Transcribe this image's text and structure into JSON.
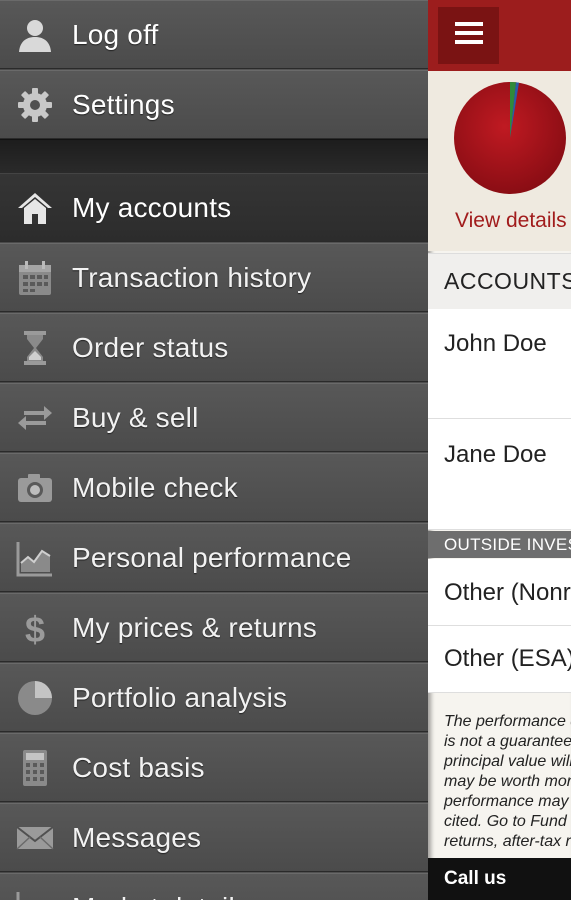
{
  "drawer": {
    "top_items": [
      {
        "label": "Log off",
        "icon": "user-icon"
      },
      {
        "label": "Settings",
        "icon": "gear-icon"
      }
    ],
    "items": [
      {
        "label": "My accounts",
        "icon": "home-icon",
        "active": true
      },
      {
        "label": "Transaction history",
        "icon": "calendar-icon"
      },
      {
        "label": "Order status",
        "icon": "hourglass-icon"
      },
      {
        "label": "Buy & sell",
        "icon": "swap-arrows-icon"
      },
      {
        "label": "Mobile check",
        "icon": "camera-icon"
      },
      {
        "label": "Personal performance",
        "icon": "area-chart-icon"
      },
      {
        "label": "My prices & returns",
        "icon": "dollar-icon"
      },
      {
        "label": "Portfolio analysis",
        "icon": "pie-chart-icon"
      },
      {
        "label": "Cost basis",
        "icon": "calculator-icon"
      },
      {
        "label": "Messages",
        "icon": "envelope-icon"
      },
      {
        "label": "Market detail",
        "icon": "line-chart-icon"
      }
    ]
  },
  "main": {
    "menu_icon": "hamburger-menu-icon",
    "view_details": "View details",
    "accounts_header": "ACCOUNTS",
    "accounts": [
      {
        "name": "John Doe"
      },
      {
        "name": "Jane Doe"
      }
    ],
    "outside_header": "OUTSIDE INVESTMENTS",
    "outside_accounts": [
      {
        "name": "Other (Nonretirement)"
      },
      {
        "name": "Other (ESA)"
      }
    ],
    "disclaimer_lines": [
      "The performance data shown represents past performance, which",
      "is not a guarantee of future results. Investment returns and",
      "principal value will fluctuate, so investors' shares, when sold,",
      "may be worth more or less than their original cost. Current",
      "performance may be lower or higher than the performance data",
      "cited. Go to Fund details for performance current to the most",
      "returns, after-tax returns"
    ],
    "call_us": "Call us",
    "colors": {
      "brand_red": "#9c1d1d",
      "pie_red": "#a8121a",
      "pie_green": "#2f8a3a",
      "pie_blue": "#2a5caa"
    }
  }
}
